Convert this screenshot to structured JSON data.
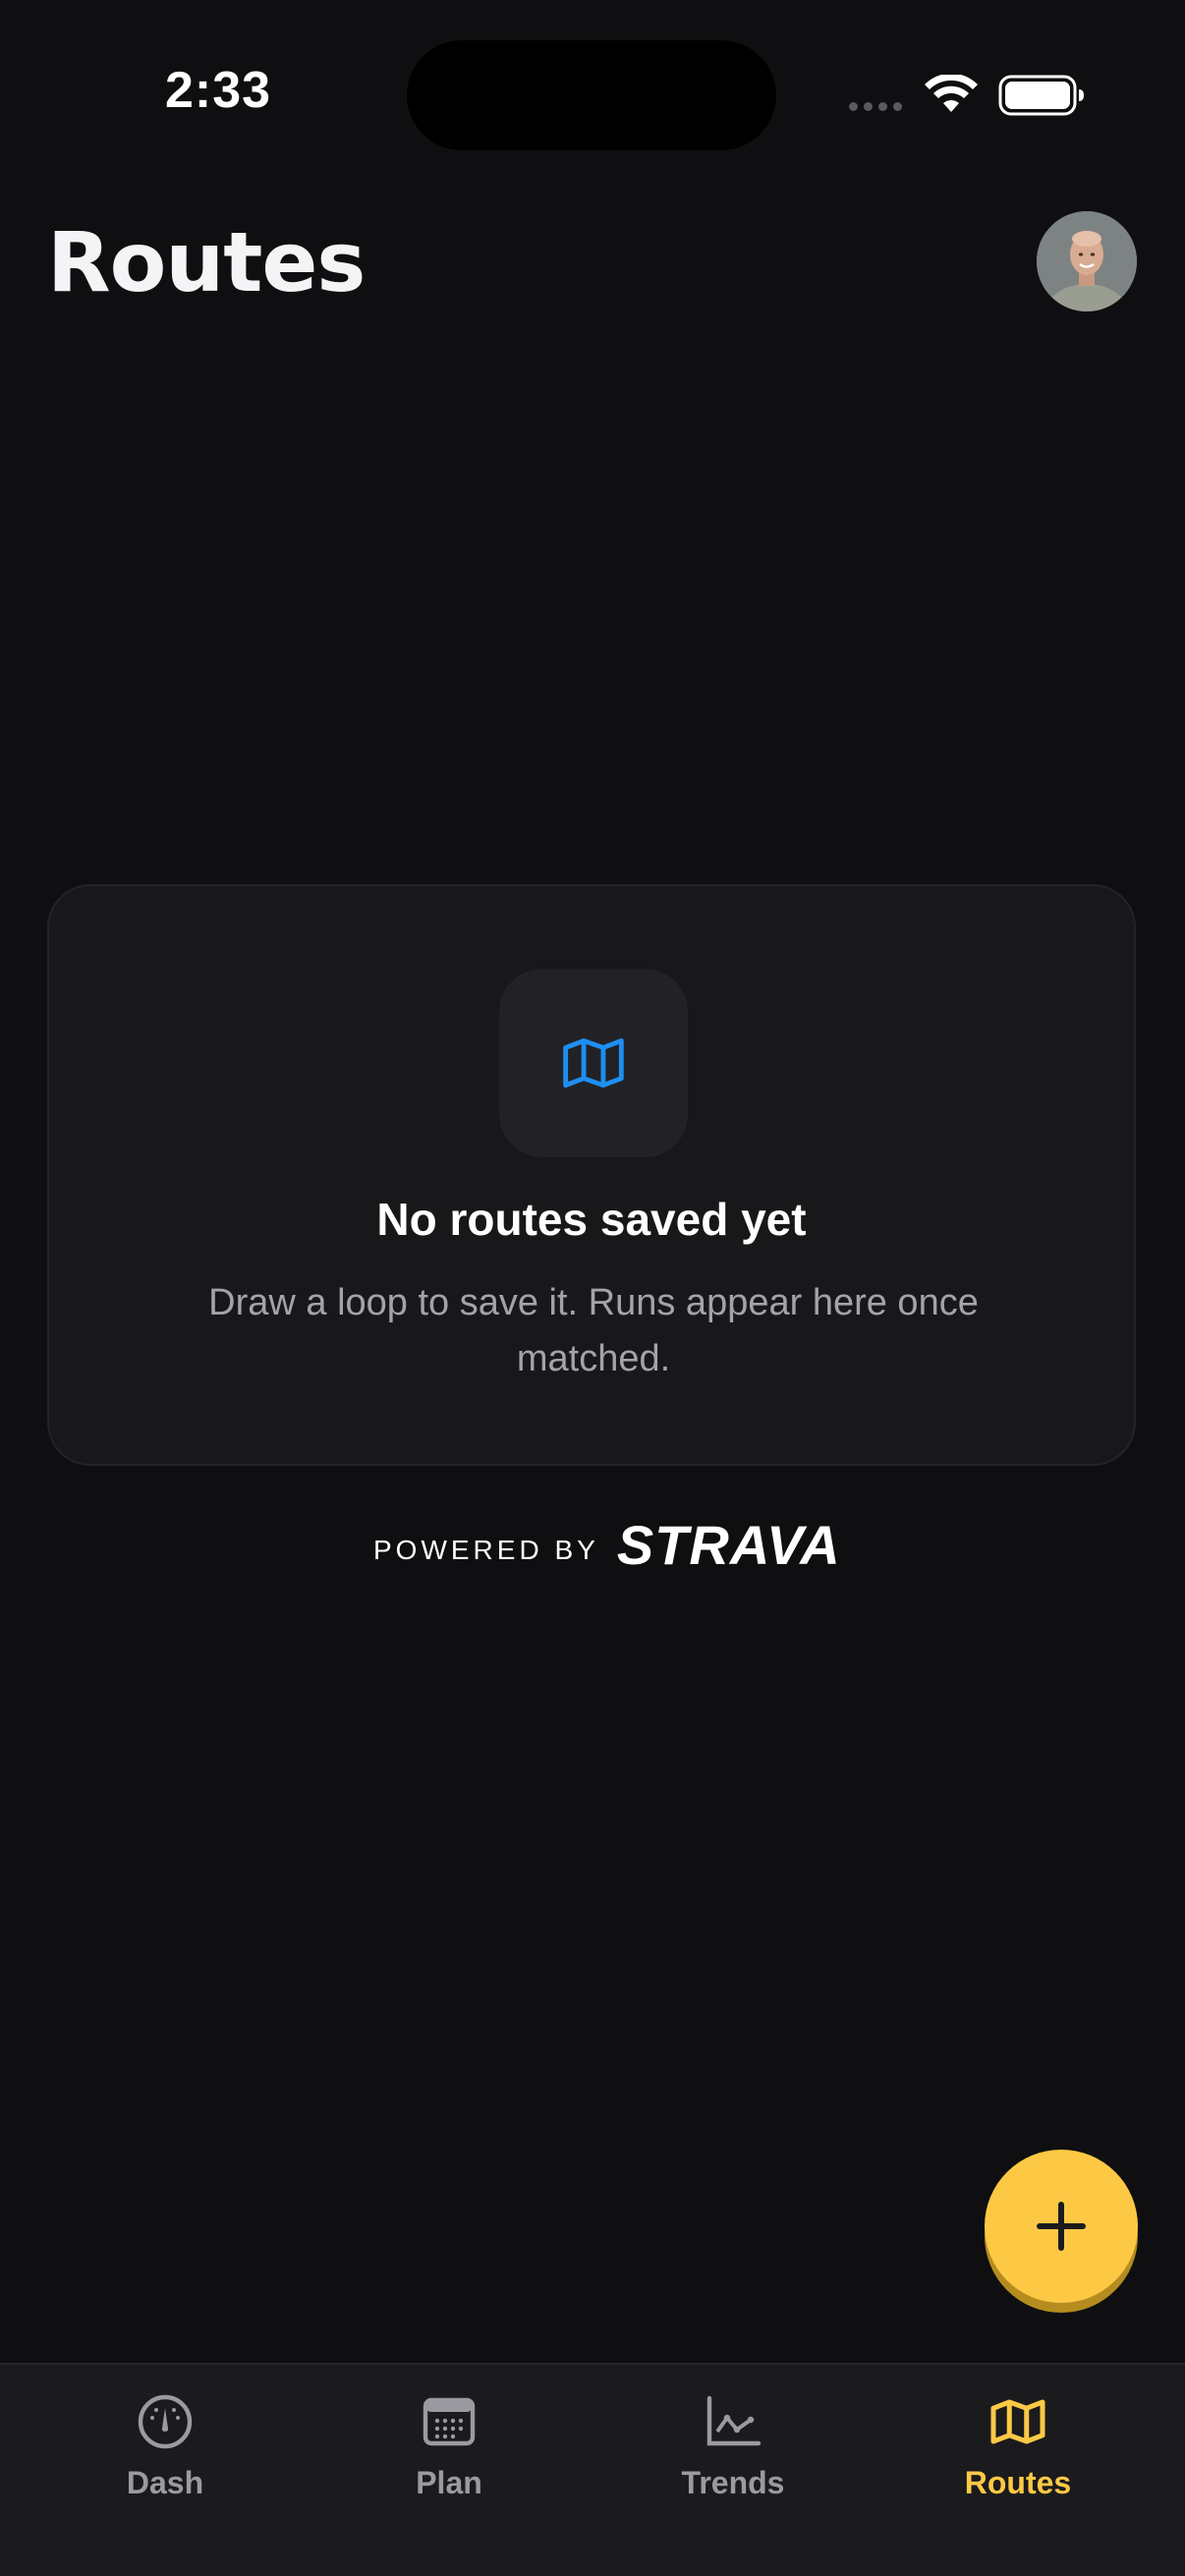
{
  "status_bar": {
    "time": "2:33"
  },
  "header": {
    "title": "Routes",
    "avatar_icon": "user-avatar"
  },
  "empty_state": {
    "icon": "map-icon",
    "title": "No routes saved yet",
    "body": "Draw a loop to save it. Runs appear here once matched."
  },
  "attribution": {
    "label": "POWERED BY",
    "brand": "STRAVA"
  },
  "fab": {
    "icon": "plus-icon"
  },
  "tabs": [
    {
      "label": "Dash",
      "icon": "gauge-icon",
      "active": false
    },
    {
      "label": "Plan",
      "icon": "calendar-icon",
      "active": false
    },
    {
      "label": "Trends",
      "icon": "line-chart-icon",
      "active": false
    },
    {
      "label": "Routes",
      "icon": "map-icon",
      "active": true
    }
  ],
  "colors": {
    "background": "#0f0f11",
    "accent": "#fdc945",
    "map_icon_blue": "#1e8ff2",
    "muted_text": "#a3a3a8"
  }
}
